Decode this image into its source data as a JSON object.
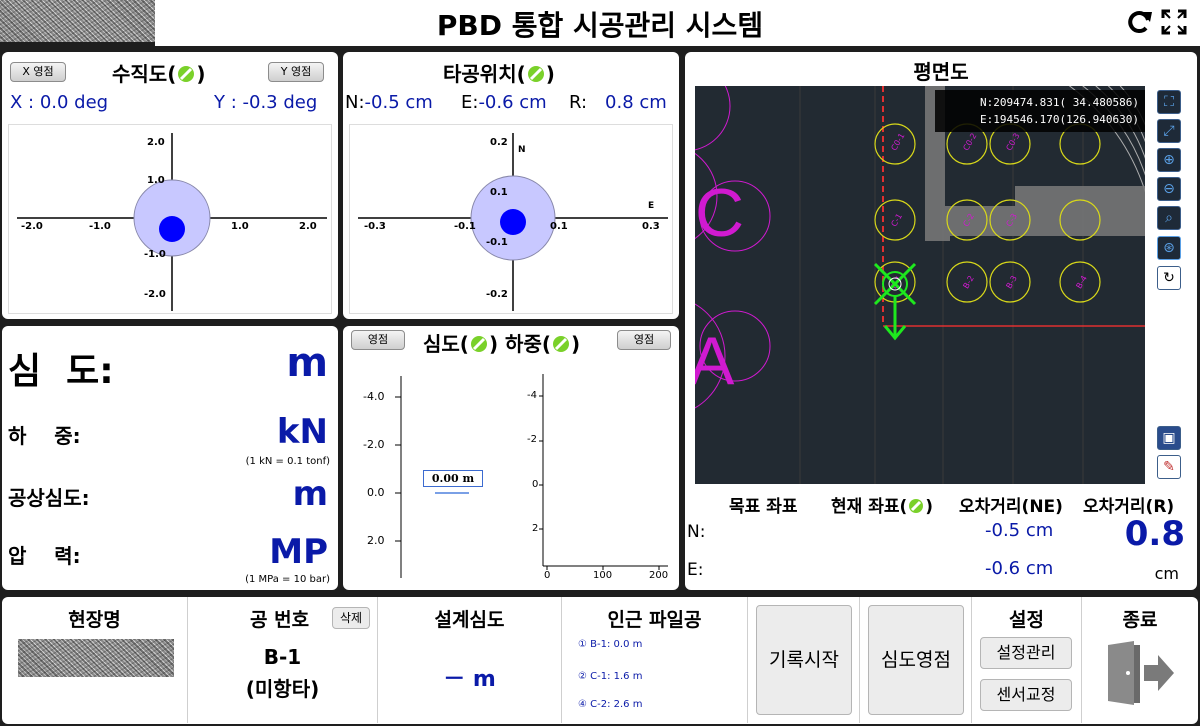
{
  "header": {
    "title": "PBD 통합 시공관리 시스템",
    "refresh_icon": "refresh-icon",
    "expand_icon": "expand-icon"
  },
  "verticality": {
    "title": "수직도(",
    "title_end": ")",
    "x_zero_button": "X 영점",
    "y_zero_button": "Y 영점",
    "x_value": "X : 0.0 deg",
    "y_value": "Y : -0.3 deg",
    "x_ticks": [
      "-2.0",
      "-1.0",
      "1.0",
      "2.0"
    ],
    "y_ticks": [
      "2.0",
      "1.0",
      "-1.0",
      "-2.0"
    ]
  },
  "position": {
    "title": "타공위치(",
    "title_end": ")",
    "n_label": "N:",
    "n_value": "-0.5 cm",
    "e_label": "E:",
    "e_value": "-0.6 cm",
    "r_label": "R:",
    "r_value": "0.8 cm",
    "x_ticks": [
      "-0.3",
      "-0.1",
      "0.1",
      "0.3"
    ],
    "y_ticks": [
      "0.2",
      "0.1",
      "-0.1",
      "-0.2"
    ],
    "axis_n": "N",
    "axis_e": "E"
  },
  "readouts": {
    "depth_label": "심  도:",
    "depth_unit": "m",
    "load_label": "하    중:",
    "load_unit": "kN",
    "load_note": "(1 kN = 0.1 tonf)",
    "hole_depth_label": "공상심도:",
    "hole_depth_unit": "m",
    "pressure_label": "압    력:",
    "pressure_unit": "MP",
    "pressure_note": "(1 MPa = 10 bar)"
  },
  "depth_load": {
    "zero_left": "영점",
    "zero_right": "영점",
    "title_a": "심도(",
    "title_b": ") 하중(",
    "title_c": ")",
    "depth_ticks": [
      "-4.0",
      "-2.0",
      "0.0",
      "2.0"
    ],
    "load_y_ticks": [
      "-4",
      "-2",
      "0",
      "2"
    ],
    "load_x_ticks": [
      "0",
      "100",
      "200"
    ],
    "depth_marker": "0.00 m"
  },
  "plan": {
    "title": "평면도",
    "coord_n": "N:209474.831( 34.480586)",
    "coord_e": "E:194546.170(126.940630)",
    "letters": [
      "C",
      "A"
    ],
    "pile_labels": [
      "C0-1",
      "C0-2",
      "C0-3",
      "C-1",
      "C-2",
      "C-3",
      "B-1",
      "B-2",
      "B-3",
      "B-4"
    ],
    "side_icons": [
      "fullscreen-icon",
      "fit-icon",
      "zoom-in-icon",
      "zoom-out-icon",
      "zoom-window-icon",
      "locate-icon",
      "rotate-icon",
      "save-icon",
      "export-icon"
    ],
    "col_target": "목표 좌표",
    "col_current_a": "현재 좌표(",
    "col_current_b": ")",
    "col_err_ne": "오차거리(NE)",
    "col_err_r": "오차거리(R)",
    "row_n": "N:",
    "row_e": "E:",
    "n_current": "-0.5 cm",
    "e_current": "-0.6 cm",
    "r_value": "0.8",
    "r_unit": "cm"
  },
  "bottom": {
    "site_label": "현장명",
    "hole_no_label": "공 번호",
    "delete_button": "삭제",
    "hole_no_value": "B-1",
    "hole_status": "(미항타)",
    "design_depth_label": "설계심도",
    "design_depth_value": "－ m",
    "nearby_label": "인근 파일공",
    "nearby": [
      "① B-1: 0.0 m",
      "② C-1: 1.6 m",
      "④ C-2: 2.6 m"
    ],
    "record_start": "기록시작",
    "depth_zero": "심도영점",
    "settings_label": "설정",
    "settings_manage": "설정관리",
    "sensor_calib": "센서교정",
    "exit_label": "종료"
  },
  "colors": {
    "accent_blue": "#0a1aa8",
    "circle_fill": "#c8c8ff",
    "dot": "#0000ff",
    "pile_yellow": "#d8d81a",
    "grid_magenta": "#d01ad0",
    "marker_green": "#1ee81e",
    "plan_bg": "#222a32"
  }
}
